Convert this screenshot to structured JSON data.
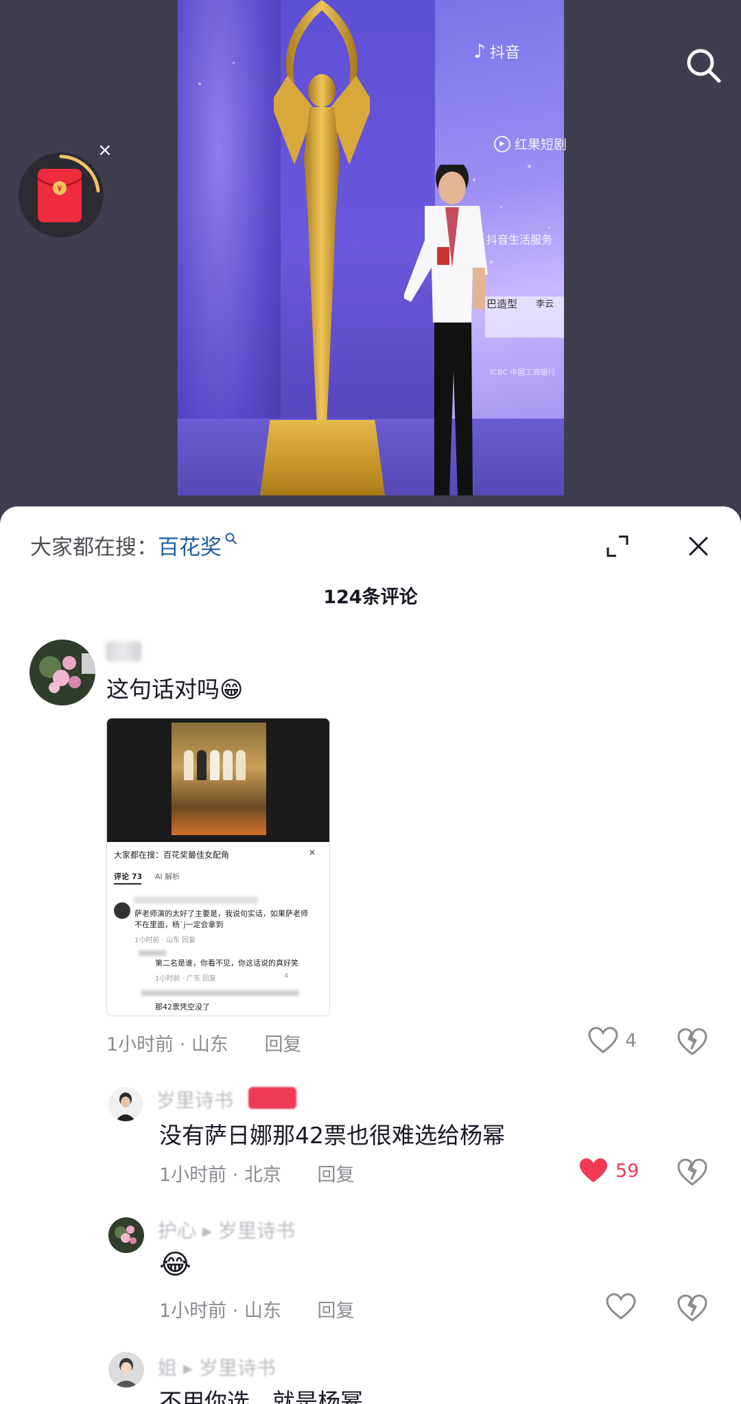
{
  "video": {
    "watermark": "抖音",
    "sponsor": "红果短剧",
    "banner_text_1": "抖音生活服务",
    "banner_text_2": "巴造型",
    "banner_text_3": "李云",
    "banner_text_4": "ICBC 中国工商银行"
  },
  "header": {
    "hot_search_prefix": "大家都在搜：",
    "hot_search_term": "百花奖",
    "comment_count": "124条评论"
  },
  "comments": [
    {
      "text": "这句话对吗😁",
      "time_location": "1小时前 · 山东",
      "reply_label": "回复",
      "likes": "4",
      "embed": {
        "search_line": "大家都在搜：百花奖最佳女配角",
        "tab_comments": "评论 73",
        "tab_ai": "AI 解析",
        "c1_line1": "萨老师演的太好了主要是，我说句实话，如果萨老师",
        "c1_line2": "不在里面，杨`j一定会拿到",
        "c1_meta": "1小时前 · 山东    回复",
        "c2_line1": "第二名是谁，你看不见，你这话说的真好笑",
        "c2_meta": "1小时前 · 广东    回复",
        "c2_likes": "4",
        "c3_line1": "那42票凭空没了"
      }
    },
    {
      "username": "岁里诗书",
      "text": "没有萨日娜那42票也很难选给杨幂",
      "time_location": "1小时前 · 北京",
      "reply_label": "回复",
      "likes": "59"
    },
    {
      "username": "护心 ▸ 岁里诗书",
      "text": "😂",
      "time_location": "1小时前 · 山东",
      "reply_label": "回复",
      "likes": ""
    },
    {
      "username": "姐 ▸ 岁里诗书",
      "text": "不用你选，就是杨幂"
    }
  ],
  "colors": {
    "accent_like": "#ef3a55",
    "link_blue": "#1d5fa3"
  }
}
